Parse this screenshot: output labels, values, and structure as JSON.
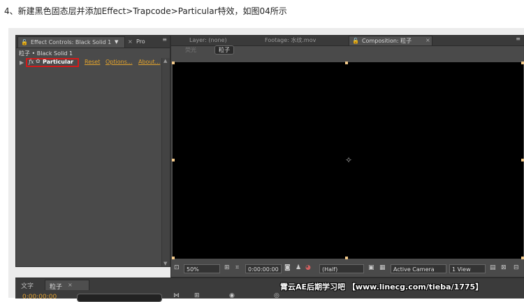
{
  "caption": "4、新建黑色固态层并添加Effect>Trapcode>Particular特效，如图04所示",
  "left_panel": {
    "tab_effect_controls": "Effect Controls: Black Solid 1",
    "tab_project": "Pro",
    "subtitle": "粒子 • Black Solid 1",
    "effect": {
      "fx_label": "fx",
      "name": "Particular",
      "reset": "Reset",
      "options": "Options...",
      "about": "About..."
    }
  },
  "viewer_panel": {
    "tabs": {
      "layer": "Layer: (none)",
      "footage": "Footage: 水纹.mov",
      "composition": "Composition: 粒子"
    },
    "breadcrumbs": [
      "荧光",
      "粒子"
    ],
    "toolbar": {
      "zoom": "50%",
      "timecode": "0:00:00:00",
      "resolution": "(Half)",
      "camera": "Active Camera",
      "views": "1 View"
    }
  },
  "timeline": {
    "tab_text": "文字",
    "tab_comp": "粒子",
    "timecode": "0:00:00:00"
  },
  "watermark": "霄云AE后期学习吧 【www.linecg.com/tieba/1775】"
}
